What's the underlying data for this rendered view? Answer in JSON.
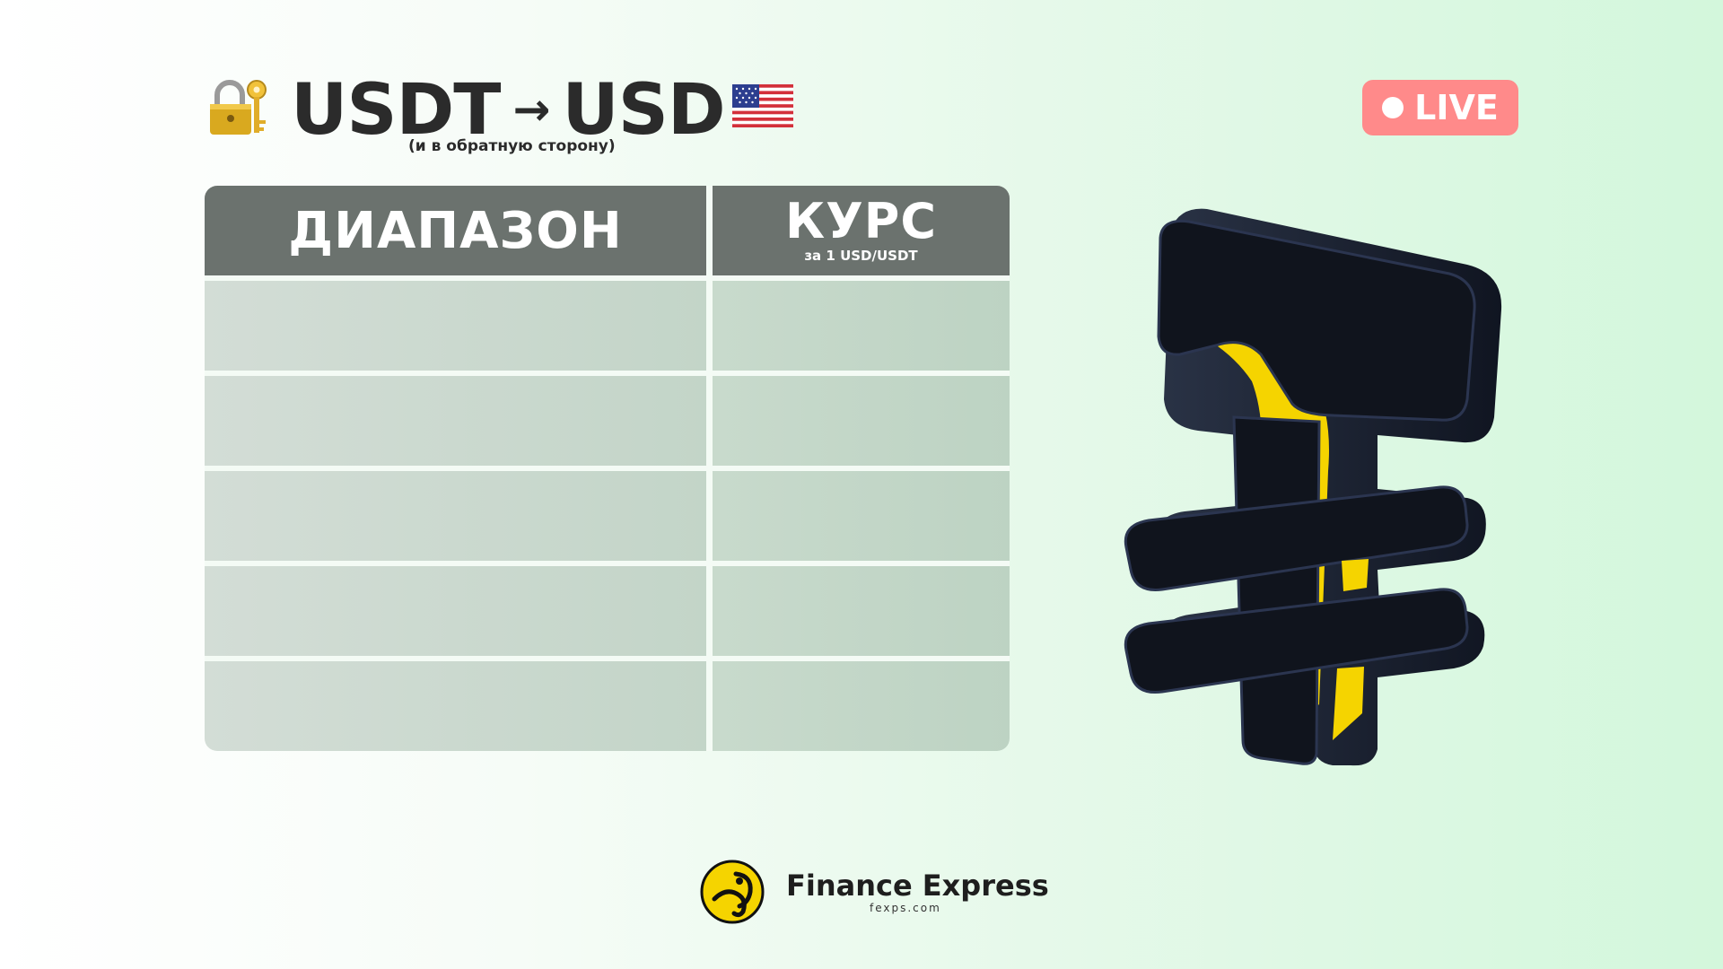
{
  "header": {
    "title_from": "USDT",
    "arrow": "→",
    "title_to": "USD",
    "subtitle": "(и в обратную сторону)",
    "lock_icon": "lock-with-key-icon",
    "flag_icon": "us-flag-icon"
  },
  "live_badge": {
    "label": "LIVE",
    "color": "#ff8a8a"
  },
  "table": {
    "header_range": "ДИАПАЗОН",
    "header_rate": "КУРС",
    "header_rate_sub": "за 1 USD/USDT",
    "rows": [
      {
        "range": "",
        "rate": ""
      },
      {
        "range": "",
        "rate": ""
      },
      {
        "range": "",
        "rate": ""
      },
      {
        "range": "",
        "rate": ""
      },
      {
        "range": "",
        "rate": ""
      }
    ]
  },
  "decoration": {
    "icon": "tenge-symbol-3d-icon",
    "colors": [
      "#1c2331",
      "#f5d400"
    ]
  },
  "brand": {
    "name": "Finance Express",
    "site": "fexps.com",
    "logo_icon": "finance-express-logo-icon",
    "logo_color": "#f5d400"
  }
}
